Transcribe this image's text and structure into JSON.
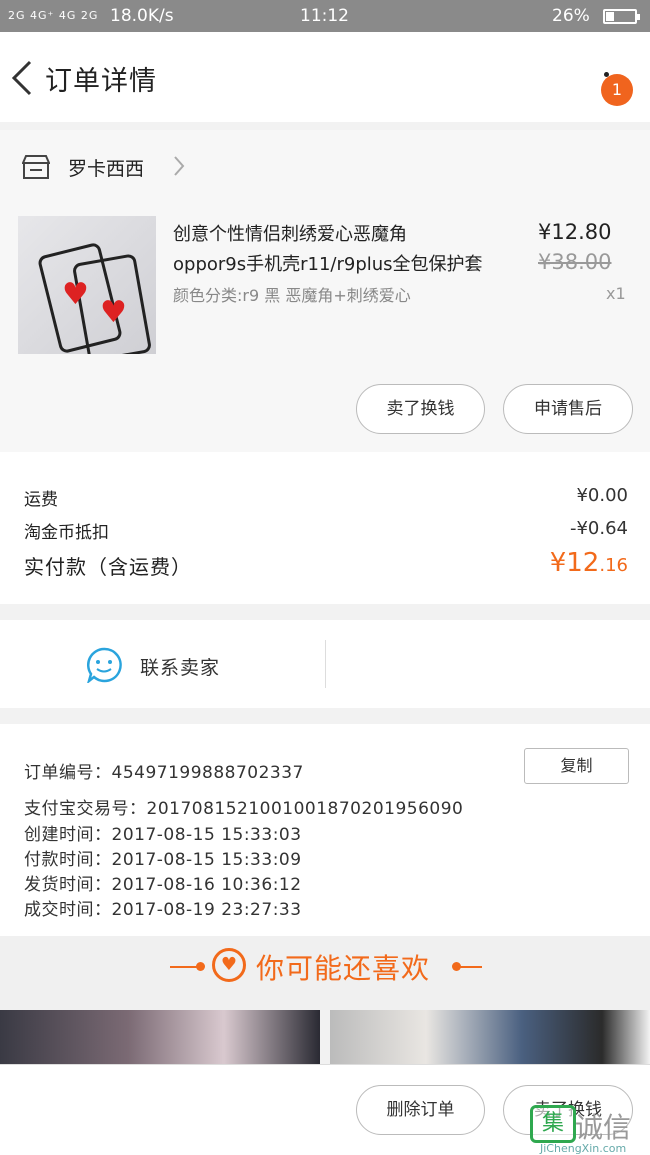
{
  "status_bar": {
    "signal": "2G 4G⁺ 4G 2G",
    "speed": "18.0K/s",
    "time": "11:12",
    "battery": "26%"
  },
  "header": {
    "title": "订单详情",
    "badge": "1"
  },
  "shop": {
    "name": "罗卡西西"
  },
  "product": {
    "title_line1": "创意个性情侣刺绣爱心恶魔角",
    "title_line2": "oppor9s手机壳r11/r9plus全包保护套",
    "variant": "颜色分类:r9 黑 恶魔角+刺绣爱心",
    "price": "¥12.80",
    "original_price": "¥38.00",
    "quantity": "x1",
    "sell_button": "卖了换钱",
    "refund_button": "申请售后"
  },
  "fees": {
    "shipping_label": "运费",
    "shipping_value": "¥0.00",
    "coin_label": "淘金币抵扣",
    "coin_value": "-¥0.64",
    "total_label": "实付款（含运费）",
    "total_main": "¥12",
    "total_decimal": ".16"
  },
  "contact": {
    "label": "联系卖家"
  },
  "order_info": {
    "order_no_label": "订单编号：",
    "order_no": "45497199888702337",
    "copy_button": "复制",
    "alipay_label": "支付宝交易号：",
    "alipay_no": "2017081521001001870201956090",
    "created_label": "创建时间：",
    "created": "2017-08-15  15:33:03",
    "paid_label": "付款时间：",
    "paid": "2017-08-15  15:33:09",
    "shipped_label": "发货时间：",
    "shipped": "2017-08-16  10:36:12",
    "completed_label": "成交时间：",
    "completed": "2017-08-19  23:27:33"
  },
  "recommend": {
    "title": "你可能还喜欢"
  },
  "bottom_bar": {
    "delete_button": "删除订单",
    "sell_button": "卖了换钱"
  },
  "watermark": {
    "text": "诚信",
    "url": "JiChengXin.com"
  },
  "colors": {
    "accent": "#f26a1b",
    "badge": "#f0641e",
    "status_bar": "#8a8a8a"
  }
}
